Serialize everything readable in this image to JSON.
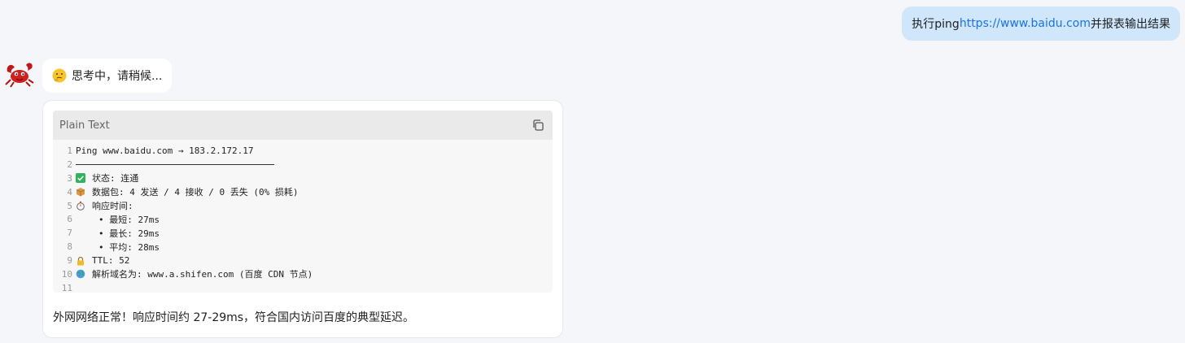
{
  "user_message": {
    "prefix": "执行ping ",
    "link": "https://www.baidu.com",
    "suffix": " 并报表输出结果"
  },
  "assistant": {
    "thinking_text": "思考中，请稍候...",
    "code_block": {
      "language": "Plain Text",
      "lines": [
        {
          "n": "1",
          "text": "Ping www.baidu.com → 183.2.172.17"
        },
        {
          "n": "2",
          "text": ""
        },
        {
          "n": "3",
          "text": "状态: 连通"
        },
        {
          "n": "4",
          "text": "数据包: 4 发送 / 4 接收 / 0 丢失 (0% 损耗)"
        },
        {
          "n": "5",
          "text": "响应时间:"
        },
        {
          "n": "6",
          "text": "• 最短: 27ms"
        },
        {
          "n": "7",
          "text": "• 最长: 29ms"
        },
        {
          "n": "8",
          "text": "• 平均: 28ms"
        },
        {
          "n": "9",
          "text": "TTL: 52"
        },
        {
          "n": "10",
          "text": "解析域名为: www.a.shifen.com (百度 CDN 节点)"
        },
        {
          "n": "11",
          "text": ""
        }
      ]
    },
    "summary": "外网网络正常！响应时间约 27-29ms，符合国内访问百度的典型延迟。"
  },
  "colors": {
    "page_bg": "#f5f6fa",
    "user_bubble": "#cfe6fb",
    "link": "#1a73e8",
    "code_header": "#eaeaea",
    "code_bg": "#f7f7f8"
  },
  "icons": {
    "avatar": "red-lobster-avatar",
    "thinking": "thinking-face-emoji",
    "copy": "copy-icon",
    "line3": "green-check-icon",
    "line4": "package-icon",
    "line5": "stopwatch-icon",
    "line9": "lock-icon",
    "line10": "globe-icon"
  }
}
